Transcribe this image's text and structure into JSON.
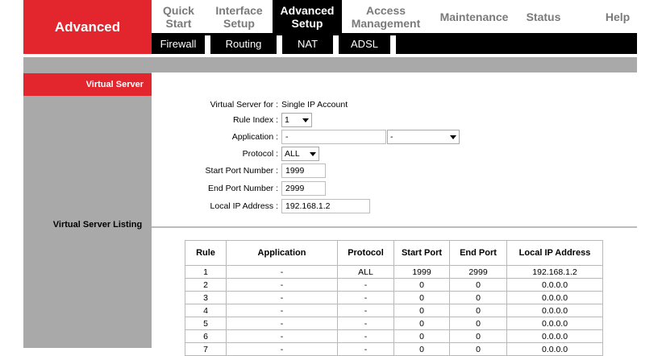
{
  "brand": "Advanced",
  "topnav": {
    "tabs": [
      {
        "label": "Quick Start",
        "lines": [
          "Quick",
          "Start"
        ]
      },
      {
        "label": "Interface Setup",
        "lines": [
          "Interface",
          "Setup"
        ]
      },
      {
        "label": "Advanced Setup",
        "lines": [
          "Advanced",
          "Setup"
        ],
        "active": true
      },
      {
        "label": "Access Management",
        "lines": [
          "Access",
          "Management"
        ]
      },
      {
        "label": "Maintenance",
        "lines": [
          "Maintenance"
        ]
      },
      {
        "label": "Status",
        "lines": [
          "Status"
        ]
      },
      {
        "label": "Help",
        "lines": [
          "Help"
        ]
      }
    ]
  },
  "subnav": [
    "Firewall",
    "Routing",
    "NAT",
    "ADSL"
  ],
  "sidebar": {
    "active_item": "Virtual Server",
    "listing_label": "Virtual Server Listing"
  },
  "form": {
    "virtual_server_for": {
      "label": "Virtual Server for :",
      "value": "Single IP Account"
    },
    "rule_index": {
      "label": "Rule Index :",
      "value": "1"
    },
    "application": {
      "label": "Application :",
      "value": "-",
      "select_value": "-"
    },
    "protocol": {
      "label": "Protocol :",
      "value": "ALL"
    },
    "start_port": {
      "label": "Start Port Number :",
      "value": "1999"
    },
    "end_port": {
      "label": "End Port Number :",
      "value": "2999"
    },
    "local_ip": {
      "label": "Local IP Address :",
      "value": "192.168.1.2"
    }
  },
  "listing": {
    "columns": [
      "Rule",
      "Application",
      "Protocol",
      "Start Port",
      "End Port",
      "Local IP Address"
    ],
    "rows": [
      [
        "1",
        "-",
        "ALL",
        "1999",
        "2999",
        "192.168.1.2"
      ],
      [
        "2",
        "-",
        "-",
        "0",
        "0",
        "0.0.0.0"
      ],
      [
        "3",
        "-",
        "-",
        "0",
        "0",
        "0.0.0.0"
      ],
      [
        "4",
        "-",
        "-",
        "0",
        "0",
        "0.0.0.0"
      ],
      [
        "5",
        "-",
        "-",
        "0",
        "0",
        "0.0.0.0"
      ],
      [
        "6",
        "-",
        "-",
        "0",
        "0",
        "0.0.0.0"
      ],
      [
        "7",
        "-",
        "-",
        "0",
        "0",
        "0.0.0.0"
      ]
    ]
  },
  "colors": {
    "brand_red": "#e3262d",
    "nav_black": "#000000",
    "sidebar_gray": "#a9a9a9"
  }
}
